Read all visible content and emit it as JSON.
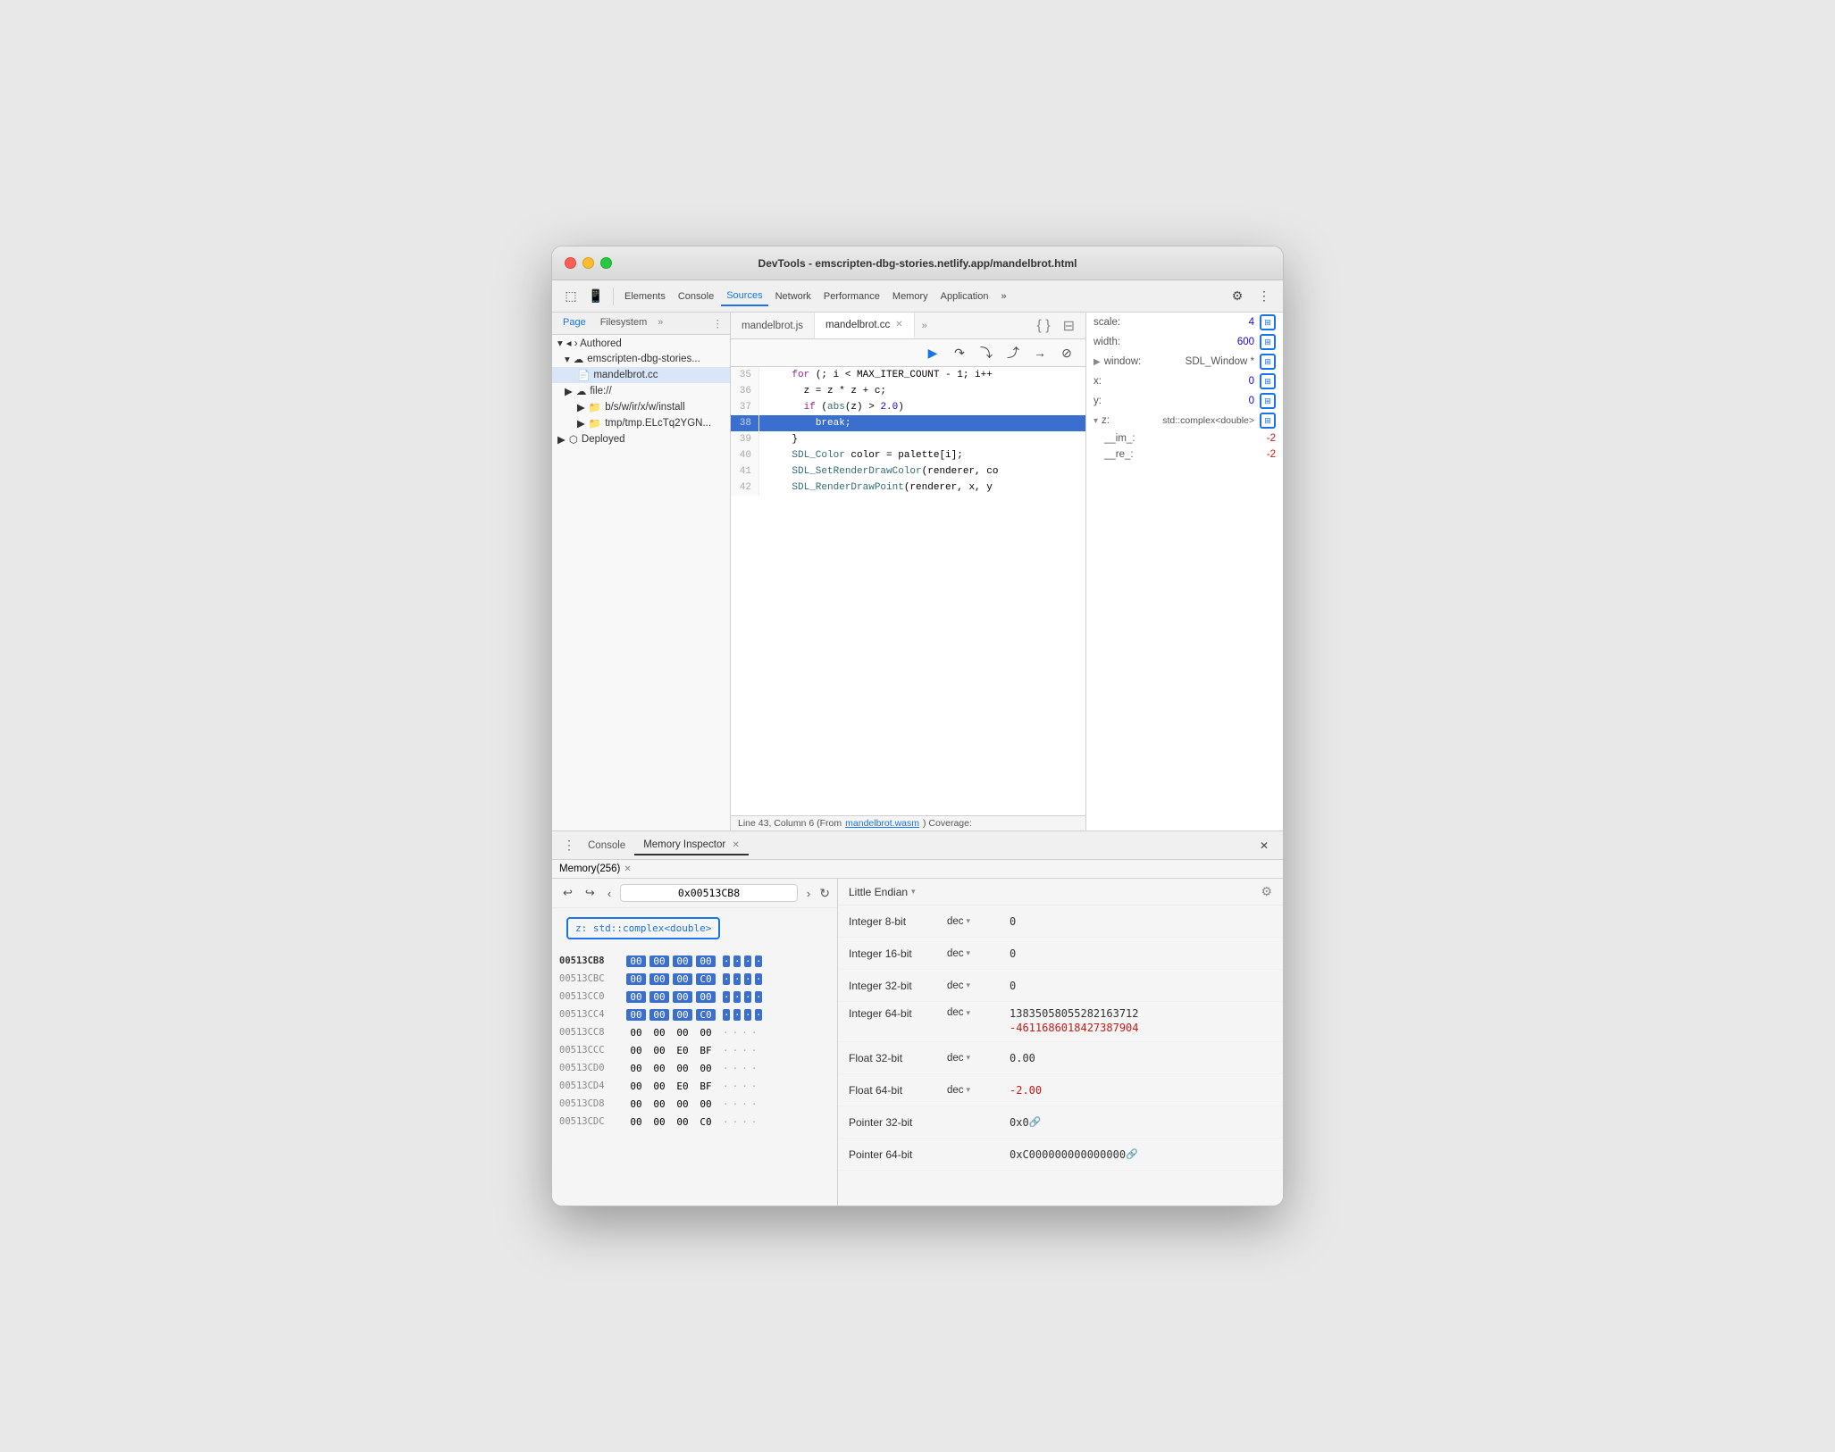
{
  "window": {
    "title": "DevTools - emscripten-dbg-stories.netlify.app/mandelbrot.html"
  },
  "toolbar": {
    "tabs": [
      {
        "id": "elements",
        "label": "Elements",
        "active": false
      },
      {
        "id": "console",
        "label": "Console",
        "active": false
      },
      {
        "id": "sources",
        "label": "Sources",
        "active": true
      },
      {
        "id": "network",
        "label": "Network",
        "active": false
      },
      {
        "id": "performance",
        "label": "Performance",
        "active": false
      },
      {
        "id": "memory",
        "label": "Memory",
        "active": false
      },
      {
        "id": "application",
        "label": "Application",
        "active": false
      },
      {
        "id": "more",
        "label": "»",
        "active": false
      }
    ]
  },
  "sidebar": {
    "tabs": [
      "Page",
      "Filesystem"
    ],
    "tree": [
      {
        "label": "◂ › Authored",
        "indent": 0
      },
      {
        "label": "emscripten-dbg-stories...",
        "indent": 1,
        "icon": "☁"
      },
      {
        "label": "mandelbrot.cc",
        "indent": 2,
        "icon": "📄",
        "selected": true
      },
      {
        "label": "▶ file://",
        "indent": 1,
        "icon": "☁"
      },
      {
        "label": "▶ b/s/w/ir/x/w/install",
        "indent": 2,
        "icon": "📁"
      },
      {
        "label": "▶ tmp/tmp.ELcTq2YGN...",
        "indent": 2,
        "icon": "📁"
      },
      {
        "label": "▶ Deployed",
        "indent": 0
      }
    ]
  },
  "editor": {
    "tabs": [
      {
        "label": "mandelbrot.js",
        "active": false
      },
      {
        "label": "mandelbrot.cc",
        "active": true,
        "closeable": true
      }
    ],
    "lines": [
      {
        "num": 35,
        "content": "    for (; i < MAX_ITER_COUNT - 1; i++",
        "highlighted": false
      },
      {
        "num": 36,
        "content": "      z = z * z + c;",
        "highlighted": false
      },
      {
        "num": 37,
        "content": "      if (abs(z) > 2.0)",
        "highlighted": false
      },
      {
        "num": 38,
        "content": "        break;",
        "highlighted": true
      },
      {
        "num": 39,
        "content": "    }",
        "highlighted": false
      },
      {
        "num": 40,
        "content": "    SDL_Color color = palette[i];",
        "highlighted": false
      },
      {
        "num": 41,
        "content": "    SDL_SetRenderDrawColor(renderer, co",
        "highlighted": false
      },
      {
        "num": 42,
        "content": "    SDL_RenderDrawPoint(renderer, x, y",
        "highlighted": false
      }
    ],
    "statusBar": "Line 43, Column 6 (From mandelbrot.wasm) Coverage:"
  },
  "scope": {
    "items": [
      {
        "label": "scale:",
        "value": "4",
        "icon": "⊞",
        "indent": 0
      },
      {
        "label": "width:",
        "value": "600",
        "icon": "⊞",
        "indent": 0
      },
      {
        "label": "▶ window:",
        "value": "SDL_Window *",
        "icon": "⊞",
        "indent": 0
      },
      {
        "label": "x:",
        "value": "0",
        "icon": "⊞",
        "indent": 0
      },
      {
        "label": "y:",
        "value": "0",
        "icon": "⊞",
        "indent": 0
      },
      {
        "label": "▼ z:",
        "value": "std::complex<double>",
        "icon": "⊞",
        "indent": 0,
        "has_blue_box": true
      },
      {
        "label": "__im_:",
        "value": "-2",
        "indent": 1
      },
      {
        "label": "__re_:",
        "value": "-2",
        "indent": 1
      }
    ]
  },
  "bottom": {
    "tabs": [
      {
        "label": "Console",
        "active": false
      },
      {
        "label": "Memory Inspector",
        "active": true,
        "closeable": true
      }
    ],
    "memory_tab": {
      "label": "Memory(256)",
      "closeable": true
    },
    "nav": {
      "address": "0x00513CB8",
      "back_label": "←",
      "forward_label": "→",
      "prev_label": "‹",
      "next_label": "›"
    },
    "label": "z: std::complex<double>",
    "hex_rows": [
      {
        "addr": "00513CB8",
        "bold": true,
        "bytes": [
          "00",
          "00",
          "00",
          "00"
        ],
        "highlighted": [
          true,
          true,
          true,
          true
        ],
        "dots": [
          "·",
          "·",
          "·",
          "·"
        ],
        "dots_hl": [
          true,
          true,
          true,
          true
        ]
      },
      {
        "addr": "00513CBC",
        "bold": false,
        "bytes": [
          "00",
          "00",
          "00",
          "C0"
        ],
        "highlighted": [
          true,
          true,
          true,
          true
        ],
        "dots": [
          "·",
          "·",
          "·",
          "·"
        ],
        "dots_hl": [
          true,
          true,
          true,
          true
        ]
      },
      {
        "addr": "00513CC0",
        "bold": false,
        "bytes": [
          "00",
          "00",
          "00",
          "00"
        ],
        "highlighted": [
          true,
          true,
          true,
          true
        ],
        "dots": [
          "·",
          "·",
          "·",
          "·"
        ],
        "dots_hl": [
          true,
          true,
          true,
          true
        ]
      },
      {
        "addr": "00513CC4",
        "bold": false,
        "bytes": [
          "00",
          "00",
          "00",
          "C0"
        ],
        "highlighted": [
          true,
          true,
          true,
          true
        ],
        "dots": [
          "·",
          "·",
          "·",
          "·"
        ],
        "dots_hl": [
          true,
          true,
          true,
          true
        ]
      },
      {
        "addr": "00513CC8",
        "bold": false,
        "bytes": [
          "00",
          "00",
          "00",
          "00"
        ],
        "highlighted": [
          false,
          false,
          false,
          false
        ],
        "dots": [
          "·",
          "·",
          "·",
          "·"
        ],
        "dots_hl": [
          false,
          false,
          false,
          false
        ]
      },
      {
        "addr": "00513CCC",
        "bold": false,
        "bytes": [
          "00",
          "00",
          "E0",
          "BF"
        ],
        "highlighted": [
          false,
          false,
          false,
          false
        ],
        "dots": [
          "·",
          "·",
          "·",
          "·"
        ],
        "dots_hl": [
          false,
          false,
          false,
          false
        ]
      },
      {
        "addr": "00513CD0",
        "bold": false,
        "bytes": [
          "00",
          "00",
          "00",
          "00"
        ],
        "highlighted": [
          false,
          false,
          false,
          false
        ],
        "dots": [
          "·",
          "·",
          "·",
          "·"
        ],
        "dots_hl": [
          false,
          false,
          false,
          false
        ]
      },
      {
        "addr": "00513CD4",
        "bold": false,
        "bytes": [
          "00",
          "00",
          "E0",
          "BF"
        ],
        "highlighted": [
          false,
          false,
          false,
          false
        ],
        "dots": [
          "·",
          "·",
          "·",
          "·"
        ],
        "dots_hl": [
          false,
          false,
          false,
          false
        ]
      },
      {
        "addr": "00513CD8",
        "bold": false,
        "bytes": [
          "00",
          "00",
          "00",
          "00"
        ],
        "highlighted": [
          false,
          false,
          false,
          false
        ],
        "dots": [
          "·",
          "·",
          "·",
          "·"
        ],
        "dots_hl": [
          false,
          false,
          false,
          false
        ]
      },
      {
        "addr": "00513CDC",
        "bold": false,
        "bytes": [
          "00",
          "00",
          "00",
          "C0"
        ],
        "highlighted": [
          false,
          false,
          false,
          false
        ],
        "dots": [
          "·",
          "·",
          "·",
          "·"
        ],
        "dots_hl": [
          false,
          false,
          false,
          false
        ]
      }
    ],
    "interpreter": {
      "endian": "Little Endian",
      "rows": [
        {
          "type": "Integer 8-bit",
          "fmt": "dec",
          "value": "0"
        },
        {
          "type": "Integer 16-bit",
          "fmt": "dec",
          "value": "0"
        },
        {
          "type": "Integer 32-bit",
          "fmt": "dec",
          "value": "0"
        },
        {
          "type": "Integer 64-bit",
          "fmt": "dec",
          "value": "13835058055282163712",
          "value2": "-4611686018427387904"
        },
        {
          "type": "Float 32-bit",
          "fmt": "dec",
          "value": "0.00"
        },
        {
          "type": "Float 64-bit",
          "fmt": "dec",
          "value": "-2.00"
        },
        {
          "type": "Pointer 32-bit",
          "fmt": "",
          "value": "0x0",
          "link": true
        },
        {
          "type": "Pointer 64-bit",
          "fmt": "",
          "value": "0xC000000000000000",
          "link": true
        }
      ]
    }
  },
  "debug_buttons": {
    "resume": "▶",
    "step_over": "↷",
    "step_into": "↓",
    "step_out": "↑",
    "step_right": "→",
    "deactivate": "⊘"
  }
}
